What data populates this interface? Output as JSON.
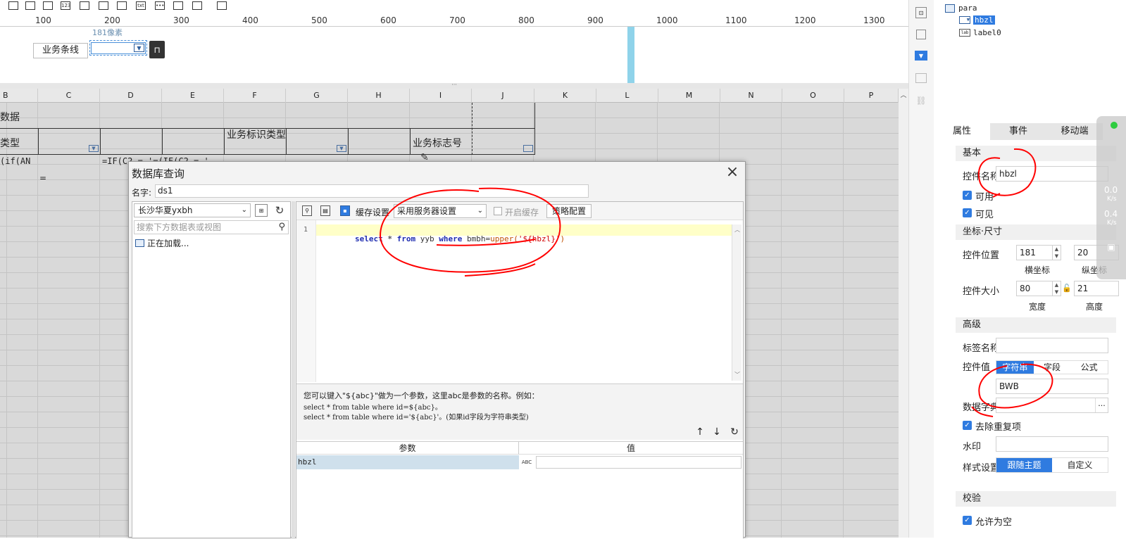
{
  "ruler": {
    "marks": [
      "100",
      "200",
      "300",
      "400",
      "500",
      "600",
      "700",
      "800",
      "900",
      "1000",
      "1100",
      "1200",
      "1300"
    ]
  },
  "form": {
    "label_text": "业务条线",
    "tooltip": "181像素"
  },
  "sheet": {
    "columns": [
      "B",
      "C",
      "D",
      "E",
      "F",
      "G",
      "H",
      "I",
      "J",
      "K",
      "L",
      "M",
      "N",
      "O",
      "P"
    ],
    "cells": {
      "r1": "数据",
      "r2_a": "类型",
      "r2_f": "业务标识类型",
      "r2_i": "业务标志号",
      "r3_a": "(if(AN",
      "r3_d": "=IF(C2 = '=(IF(C2 = '",
      "r4_c": "="
    }
  },
  "dialog": {
    "title": "数据库查询",
    "name_label": "名字:",
    "name_value": "ds1",
    "connection": "长沙华夏yxbh",
    "search_placeholder": "搜索下方数据表或视图",
    "loading": "正在加载...",
    "cache_label": "缓存设置",
    "cache_select": "采用服务器设置",
    "enable_cache": "开启缓存",
    "strategy": "策略配置",
    "line_no": "1",
    "sql": {
      "kw1": "select",
      "star": " *",
      "kw2": "from",
      "tbl": " yyb ",
      "kw3": "where",
      "col": " bmbh=",
      "fn": "upper(",
      "param": "'${hbzl}'",
      "close": ")"
    },
    "hint_line1": "您可以键入\"${abc}\"做为一个参数，这里abc是参数的名称。例如：",
    "hint_line2": "select * from table where id=${abc}。",
    "hint_line3": "select * from table where id='${abc}'。(如果id字段为字符串类型)",
    "param_header": "参数",
    "value_header": "值",
    "param_row": "hbzl",
    "close_icon": "×"
  },
  "tree": {
    "root": "para",
    "child1": "hbzl",
    "child2": "label0"
  },
  "panel": {
    "tabs": [
      "属性",
      "事件",
      "移动端"
    ],
    "basic": "基本",
    "control_name_label": "控件名称",
    "control_name_value": "hbzl",
    "enabled": "可用",
    "visible": "可见",
    "coord_section": "坐标·尺寸",
    "pos_label": "控件位置",
    "pos_x": "181",
    "pos_y": "20",
    "x_label": "横坐标",
    "y_label": "纵坐标",
    "size_label": "控件大小",
    "width": "80",
    "height": "21",
    "w_label": "宽度",
    "h_label": "高度",
    "advanced": "高级",
    "tag_label": "标签名称",
    "ctrl_value_label": "控件值",
    "value_tabs": [
      "字符串",
      "字段",
      "公式"
    ],
    "value": "BWB",
    "dict_label": "数据字典",
    "dedupe": "去除重复项",
    "watermark": "水印",
    "style_label": "样式设置",
    "style_opts": [
      "跟随主题",
      "自定义"
    ],
    "validate": "校验",
    "allow_empty": "允许为空"
  },
  "net": {
    "up": "0.0",
    "up_unit": "K/s",
    "down": "0.4",
    "down_unit": "K/s"
  },
  "colors": {
    "accent": "#2f7be0",
    "sql_highlight": "#ffffc8",
    "annotation": "#ff0000",
    "grid_bg": "#d9d9d9"
  }
}
